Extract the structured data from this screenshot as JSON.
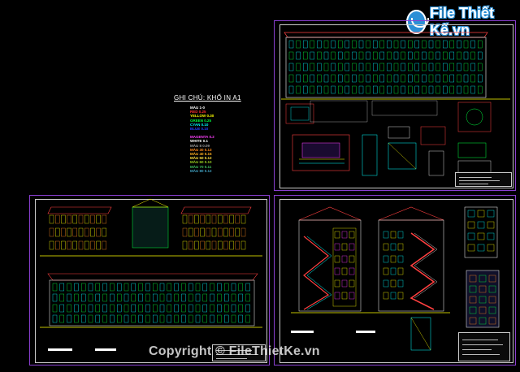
{
  "logo": {
    "text": "File Thiết Kế.vn"
  },
  "legend": {
    "title": "GHI CHÚ: KHỔ IN A1",
    "items": [
      {
        "label": "MÀU 1-0",
        "color": "#ffffff"
      },
      {
        "label": "RED 0.25",
        "color": "#ff3030"
      },
      {
        "label": "YELLOW 0.30",
        "color": "#ffff00"
      },
      {
        "label": "GREEN 0.25",
        "color": "#00ff40"
      },
      {
        "label": "CYAN 0.10",
        "color": "#00ffff"
      },
      {
        "label": "BLUE 0.10",
        "color": "#2040ff"
      },
      {
        "label": "MAGENTA 0.2",
        "color": "#ff40ff"
      },
      {
        "label": "WHITE 0.1",
        "color": "#ffffff"
      },
      {
        "label": "MÀU 8 0.09",
        "color": "#9a9a9a"
      },
      {
        "label": "MÀU 30 0.13",
        "color": "#ff8a1c"
      },
      {
        "label": "MÀU 40 0.15",
        "color": "#ffb020"
      },
      {
        "label": "MÀU 50 0.12",
        "color": "#ffe040"
      },
      {
        "label": "MÀU 60 0.10",
        "color": "#9ad020"
      },
      {
        "label": "MÀU 70 0.11",
        "color": "#40c060"
      },
      {
        "label": "MÀU 80 0.12",
        "color": "#40a0c0"
      }
    ]
  },
  "watermark": "Copyright © FileThietKe.vn",
  "colors": {
    "sheet_border": "#8a3fd0",
    "accent": "#2b8fd6"
  }
}
